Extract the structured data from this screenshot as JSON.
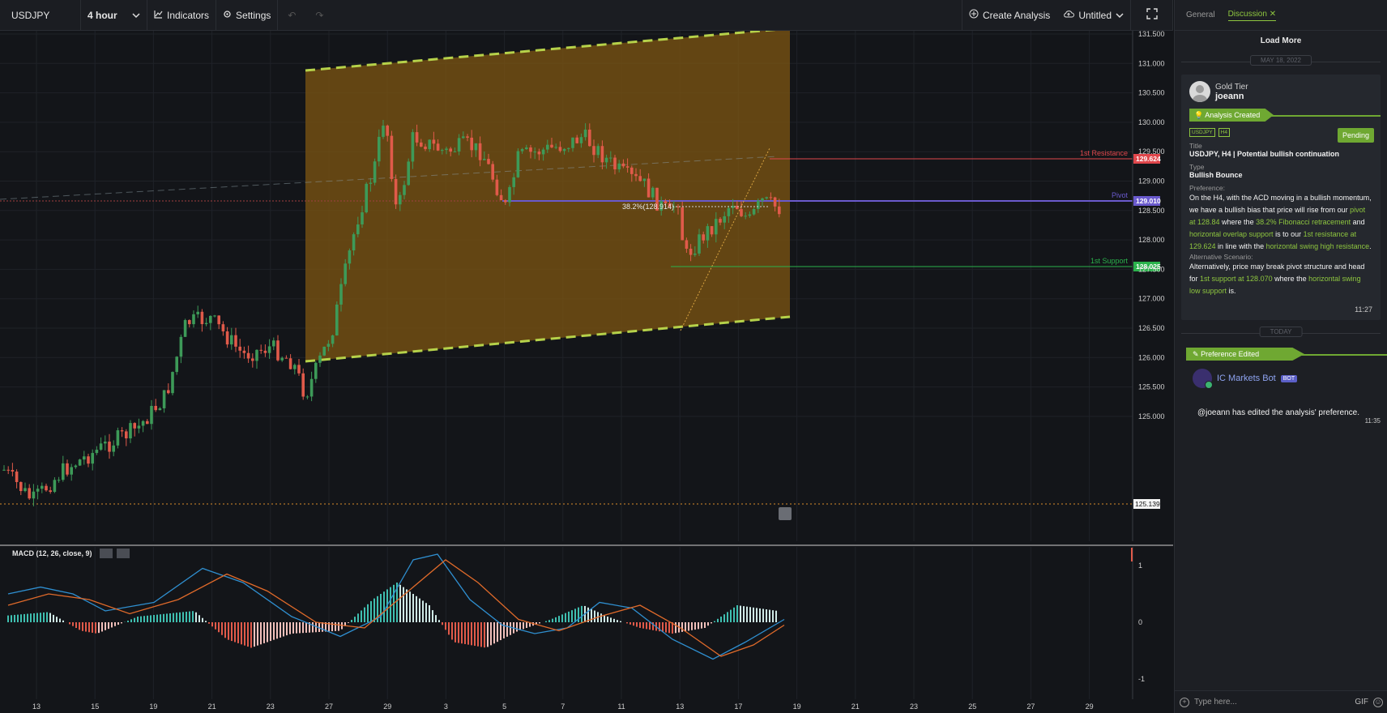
{
  "toolbar": {
    "symbol": "USDJPY",
    "interval": "4 hour",
    "indicators_label": "Indicators",
    "settings_label": "Settings",
    "create_analysis_label": "Create Analysis",
    "untitled_label": "Untitled"
  },
  "chart": {
    "price_axis_ticks": [
      "131.500",
      "131.000",
      "130.500",
      "130.000",
      "129.500",
      "129.000",
      "128.500",
      "128.000",
      "127.500",
      "127.000",
      "126.500",
      "126.000",
      "125.500",
      "125.000"
    ],
    "date_ticks": [
      "13",
      "15",
      "19",
      "21",
      "23",
      "27",
      "29",
      "3",
      "5",
      "7",
      "11",
      "13",
      "17",
      "19",
      "21",
      "23",
      "25",
      "27",
      "29"
    ],
    "levels": {
      "resistance": {
        "label": "1st Resistance",
        "price": "129.624",
        "color": "#e0474c"
      },
      "pivot": {
        "label": "Pivot",
        "price": "129.010",
        "color": "#6a5acd"
      },
      "support": {
        "label": "1st Support",
        "price": "128.025",
        "color": "#2bb24c"
      },
      "current": {
        "price": "125.139"
      }
    },
    "fib_label": "38.2%(128.914)",
    "macd_label": "MACD (12, 26, close, 9)",
    "macd_ticks": [
      "1",
      "0",
      "-1"
    ]
  },
  "panel": {
    "tabs": {
      "general": "General",
      "discussion": "Discussion"
    },
    "load_more": "Load More",
    "date_separator_1": "MAY 18, 2022",
    "date_separator_2": "TODAY",
    "post": {
      "tier": "Gold Tier",
      "username": "joeann",
      "event": "Analysis Created",
      "tags": [
        "USDJPY",
        "H4"
      ],
      "status": "Pending",
      "title_label": "Title",
      "title": "USDJPY, H4 | Potential bullish continuation",
      "type_label": "Type",
      "type": "Bullish Bounce",
      "preference_label": "Preference:",
      "preference_parts": [
        "On the H4, with the ACD moving in a bullish momentum, we have a bullish bias that price will rise from our ",
        "pivot at 128.84",
        " where the ",
        "38.2% Fibonacci retracement",
        " and ",
        "horizontal overlap support",
        " is to our ",
        "1st resistance at 129.624",
        " in line with the ",
        "horizontal swing high resistance",
        "."
      ],
      "alt_label": "Alternative Scenario:",
      "alt_parts": [
        "Alternatively, price may break pivot structure and head for ",
        "1st support at 128.070",
        " where the ",
        "horizontal swing low support",
        " is."
      ],
      "time": "11:27"
    },
    "edit_event": "Preference Edited",
    "bot": {
      "name": "IC Markets Bot",
      "badge": "BOT",
      "message": "@joeann has edited the analysis' preference.",
      "time": "11:35"
    },
    "composer": {
      "placeholder": "Type here...",
      "gif_label": "GIF"
    }
  }
}
